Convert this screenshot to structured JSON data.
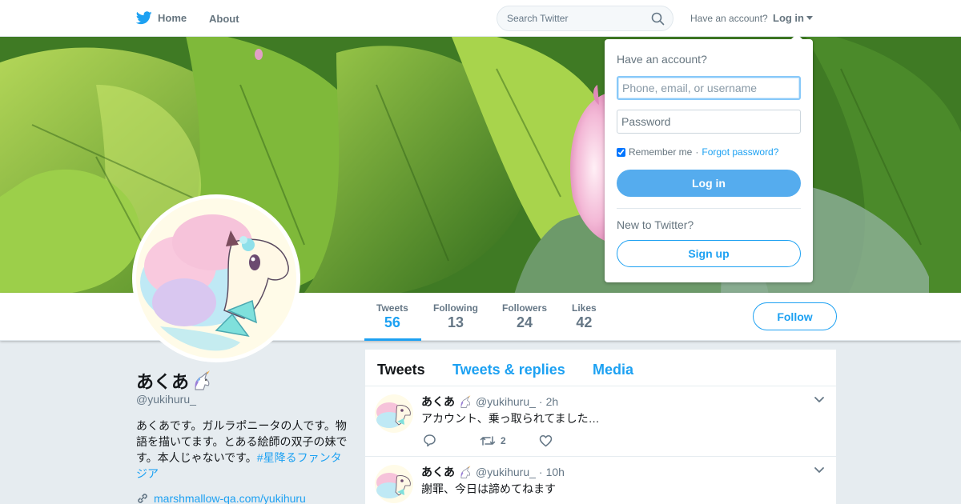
{
  "topbar": {
    "home_label": "Home",
    "about_label": "About",
    "search_placeholder": "Search Twitter",
    "have_account": "Have an account?",
    "login_label": "Log in",
    "icons": {
      "logo": "twitter-bird-icon",
      "search": "search-icon",
      "caret": "caret-down-icon"
    }
  },
  "login_dropdown": {
    "title": "Have an account?",
    "username_placeholder": "Phone, email, or username",
    "password_placeholder": "Password",
    "remember_label": "Remember me",
    "separator": "·",
    "forgot_label": "Forgot password?",
    "remember_checked": true,
    "login_button": "Log in",
    "new_label": "New to Twitter?",
    "signup_button": "Sign up"
  },
  "profile": {
    "name": "あくあ",
    "handle": "@yukihuru_",
    "bio_text": "あくあです。ガルラポニータの人です。物語を描いてます。とある絵師の双子の妹です。本人じゃないです。",
    "bio_hashtag": "#星降るファンタジア",
    "link": "marshmallow-qa.com/yukihuru",
    "icons": {
      "name_emoji": "unicorn-icon",
      "link": "link-icon"
    }
  },
  "stats": [
    {
      "label": "Tweets",
      "value": "56",
      "active": true
    },
    {
      "label": "Following",
      "value": "13",
      "active": false
    },
    {
      "label": "Followers",
      "value": "24",
      "active": false
    },
    {
      "label": "Likes",
      "value": "42",
      "active": false
    }
  ],
  "follow_button": "Follow",
  "timeline": {
    "tabs": [
      {
        "label": "Tweets",
        "active": true
      },
      {
        "label": "Tweets & replies",
        "active": false
      },
      {
        "label": "Media",
        "active": false
      }
    ],
    "tweets": [
      {
        "name": "あくあ",
        "handle": "@yukihuru_",
        "sep": "·",
        "time": "2h",
        "text": "アカウント、乗っ取られてました…",
        "retweets": "2"
      },
      {
        "name": "あくあ",
        "handle": "@yukihuru_",
        "sep": "·",
        "time": "10h",
        "text": "謝罪、今日は諦めてねます"
      }
    ]
  },
  "colors": {
    "accent": "#1da1f2",
    "login_button": "#55acee",
    "background": "#e6ecf0",
    "secondary_text": "#657786"
  }
}
